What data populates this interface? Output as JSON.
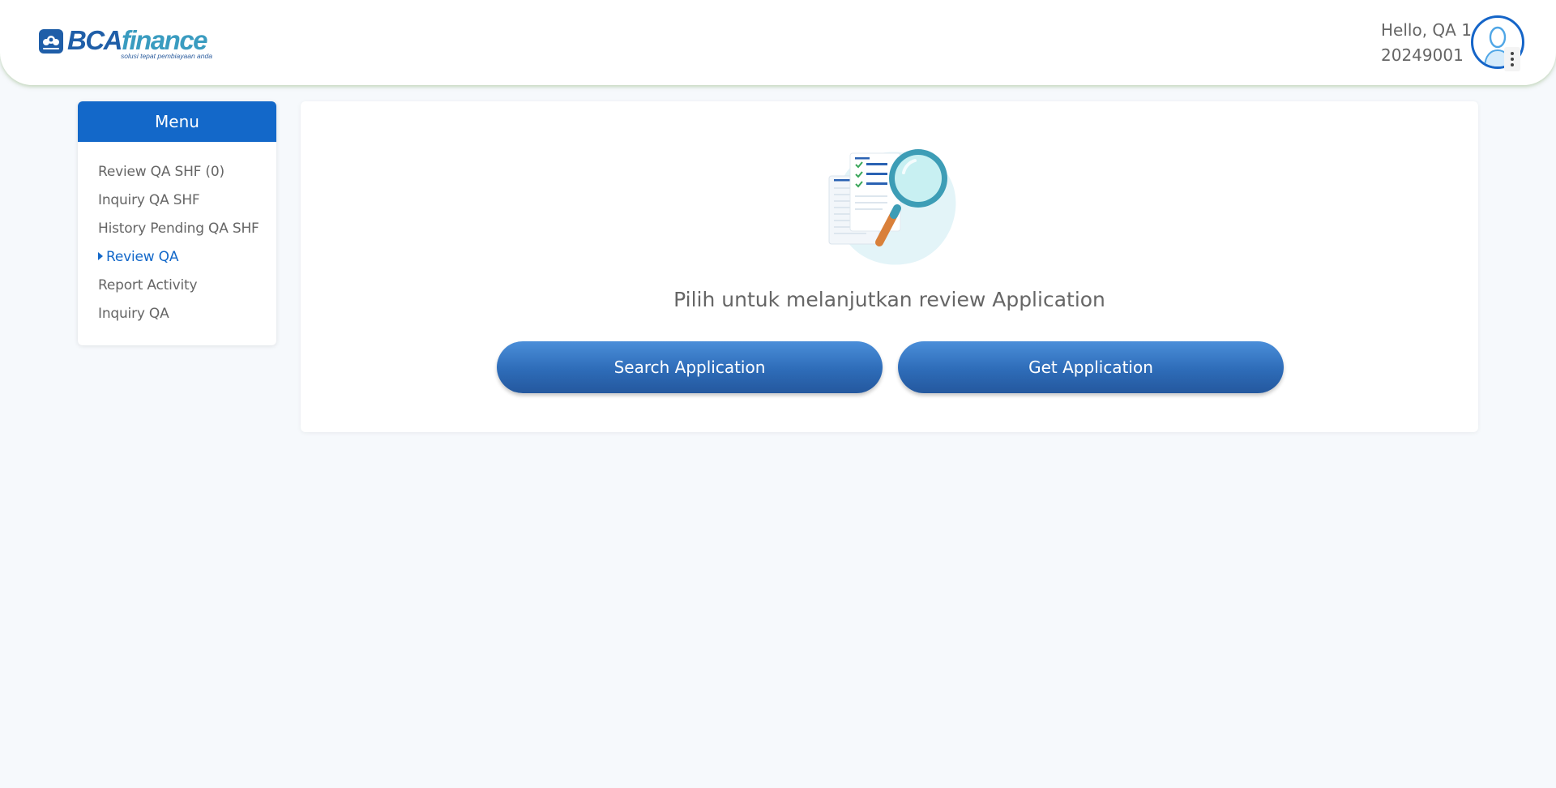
{
  "header": {
    "logo": {
      "brand_primary": "BCA",
      "brand_secondary": "finance",
      "tagline": "solusi tepat pembiayaan anda"
    },
    "user": {
      "greeting": "Hello, QA 1",
      "id": "20249001",
      "avatar_icon": "user-avatar-icon",
      "menu_icon": "kebab-menu-icon"
    }
  },
  "sidebar": {
    "title": "Menu",
    "items": [
      {
        "label": "Review QA SHF (0)",
        "active": false
      },
      {
        "label": "Inquiry QA SHF",
        "active": false
      },
      {
        "label": "History Pending QA SHF",
        "active": false
      },
      {
        "label": "Review QA",
        "active": true
      },
      {
        "label": "Report Activity",
        "active": false
      },
      {
        "label": "Inquiry QA",
        "active": false
      }
    ]
  },
  "main": {
    "illustration_icon": "document-search-illustration",
    "prompt": "Pilih untuk melanjutkan review Application",
    "buttons": {
      "search": "Search Application",
      "get": "Get Application"
    }
  },
  "colors": {
    "accent": "#1368c9",
    "background": "#f6f9fc",
    "button_gradient_top": "#4a8ed9",
    "button_gradient_bottom": "#24589e"
  }
}
